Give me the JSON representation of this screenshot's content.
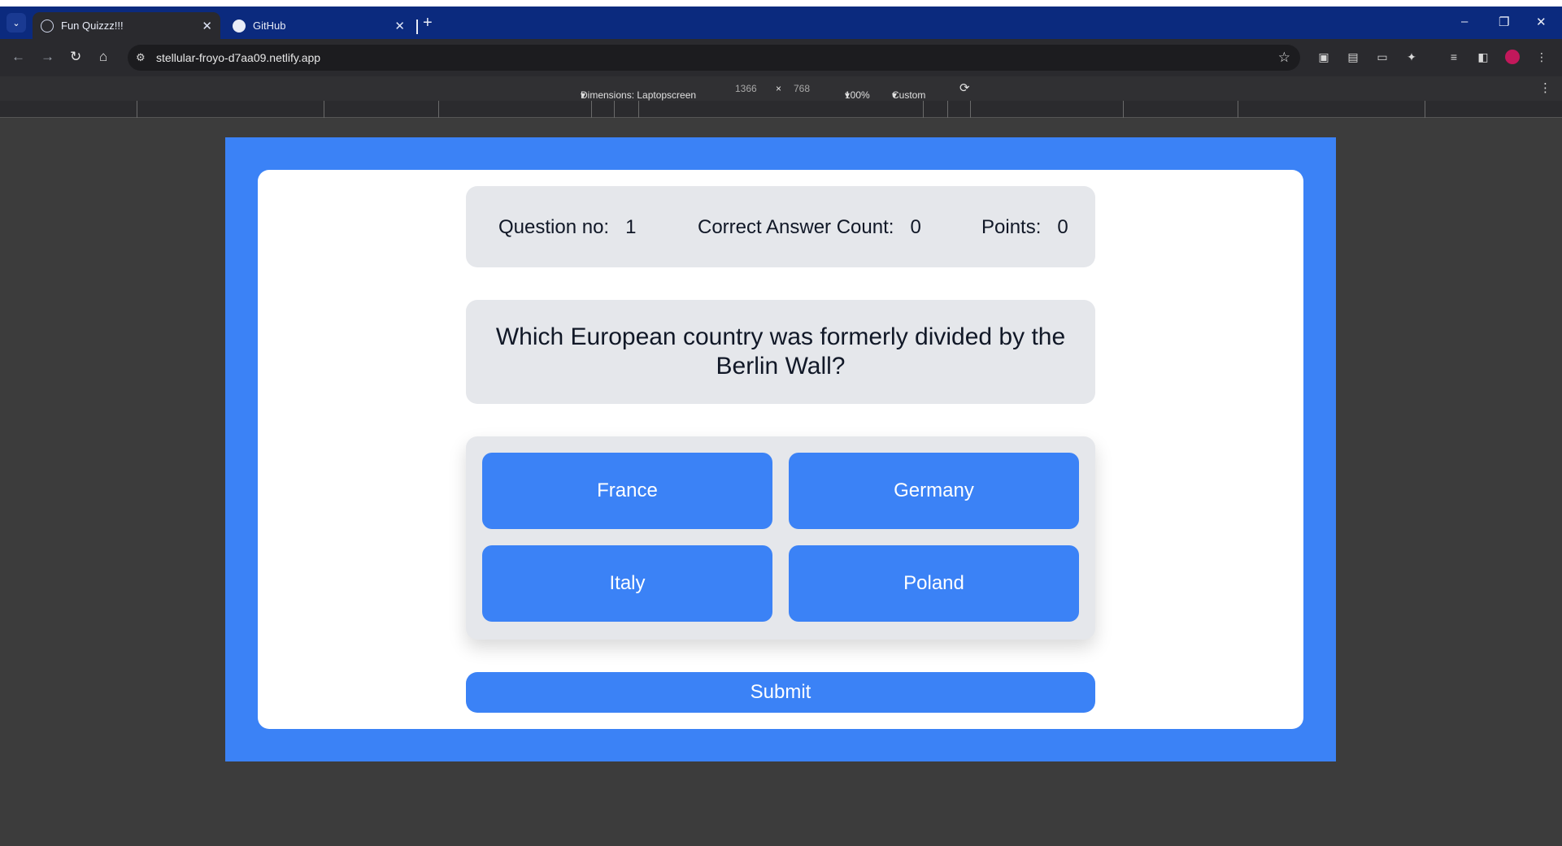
{
  "browser": {
    "tabs": [
      {
        "title": "Fun Quizzz!!!",
        "icon": "globe-icon",
        "active": true
      },
      {
        "title": "GitHub",
        "icon": "github-icon",
        "active": false
      }
    ],
    "url": "stellular-froyo-d7aa09.netlify.app",
    "new_tab_glyph": "+",
    "close_glyph": "✕",
    "window_controls": [
      "–",
      "❐",
      "✕"
    ]
  },
  "devtools": {
    "dimensions_label": "Dimensions: Laptopscreen",
    "width": "1366",
    "times": "×",
    "height": "768",
    "zoom": "100%",
    "throttle": "Custom",
    "caret": "▾"
  },
  "quiz": {
    "question_no_label": "Question no:",
    "question_no_value": "1",
    "correct_label": "Correct Answer Count:",
    "correct_value": "0",
    "points_label": "Points:",
    "points_value": "0",
    "question_text": "Which European country was formerly divided by the Berlin Wall?",
    "options": [
      "France",
      "Germany",
      "Italy",
      "Poland"
    ],
    "submit_label": "Submit"
  },
  "colors": {
    "accent": "#3b82f6",
    "panel": "#e5e7eb",
    "tabbar": "#0b2a7e"
  }
}
